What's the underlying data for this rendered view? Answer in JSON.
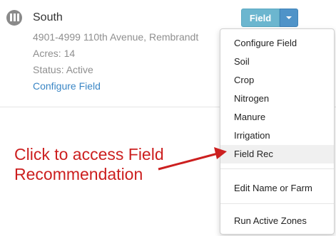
{
  "field": {
    "name": "South",
    "address": "4901-4999 110th Avenue, Rembrandt",
    "acres": "Acres: 14",
    "status": "Status: Active",
    "configure_link": "Configure Field"
  },
  "toolbar": {
    "field_button_label": "Field"
  },
  "menu": {
    "items": [
      {
        "label": "Configure Field"
      },
      {
        "label": "Soil"
      },
      {
        "label": "Crop"
      },
      {
        "label": "Nitrogen"
      },
      {
        "label": "Manure"
      },
      {
        "label": "Irrigation"
      },
      {
        "label": "Field Rec"
      },
      {
        "label": "Edit Name or Farm"
      },
      {
        "label": "Run Active Zones"
      }
    ]
  },
  "annotation": {
    "line1": "Click to access Field",
    "line2": "Recommendation"
  },
  "colors": {
    "accent_button": "#6cb6cf",
    "caret_button": "#4f93c8",
    "link": "#3a86c5",
    "annotation": "#cc1f1f"
  }
}
